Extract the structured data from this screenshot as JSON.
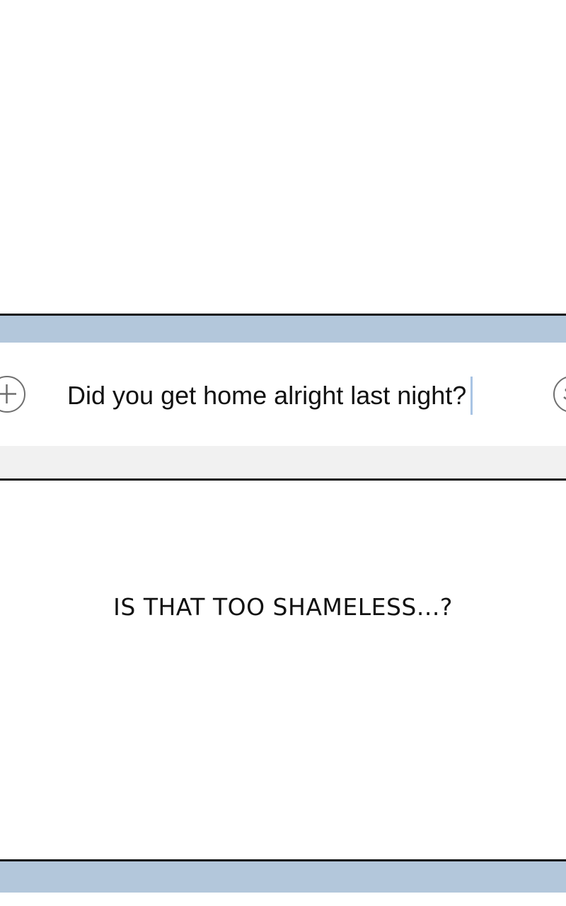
{
  "colors": {
    "top_bar": "#b3c7db",
    "bottom_bar": "#f1f1f1",
    "caret": "#a9c4e4",
    "icon_stroke": "#6f6f6f"
  },
  "compose": {
    "add_icon": "plus-circle-icon",
    "message_text": "Did you get home alright last night?",
    "emoji_icon": "smiley-face-icon"
  },
  "caption": {
    "text": "IS THAT TOO SHAMELESS...?"
  }
}
